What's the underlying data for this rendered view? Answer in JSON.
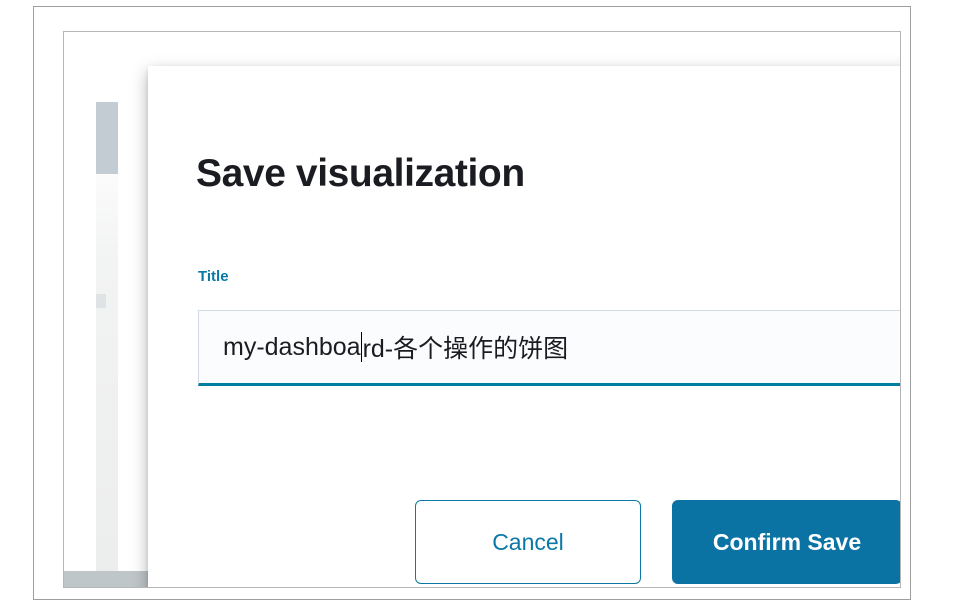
{
  "window": {
    "frame_border_color": "#9e9e9e",
    "inner_border_color": "#b6b6b6"
  },
  "background": {
    "sidebar_strip_color": "#c2ccd2",
    "bottom_bar_color": "#b6b1bd",
    "legend_bands": [
      {
        "name": "band-white",
        "color": "#f7f8f8"
      },
      {
        "name": "band-tan",
        "color": "#ddd5c2"
      },
      {
        "name": "band-green",
        "color": "#c8e2d0"
      },
      {
        "name": "band-pink",
        "color": "#ddc5dd"
      }
    ]
  },
  "modal": {
    "title": "Save visualization",
    "close_icon": "close-icon",
    "accent_color": "#0a73a3",
    "label_color": "#0b79a8",
    "field": {
      "label": "Title",
      "value": "my-dashboard-各个操作的饼图",
      "placeholder": "",
      "caret_after": "my-dashboa",
      "value_before_caret": "my-dashboa",
      "value_after_caret": "rd-各个操作的饼图",
      "underline_color": "#017d9f"
    },
    "buttons": {
      "cancel_label": "Cancel",
      "confirm_label": "Confirm Save"
    }
  }
}
